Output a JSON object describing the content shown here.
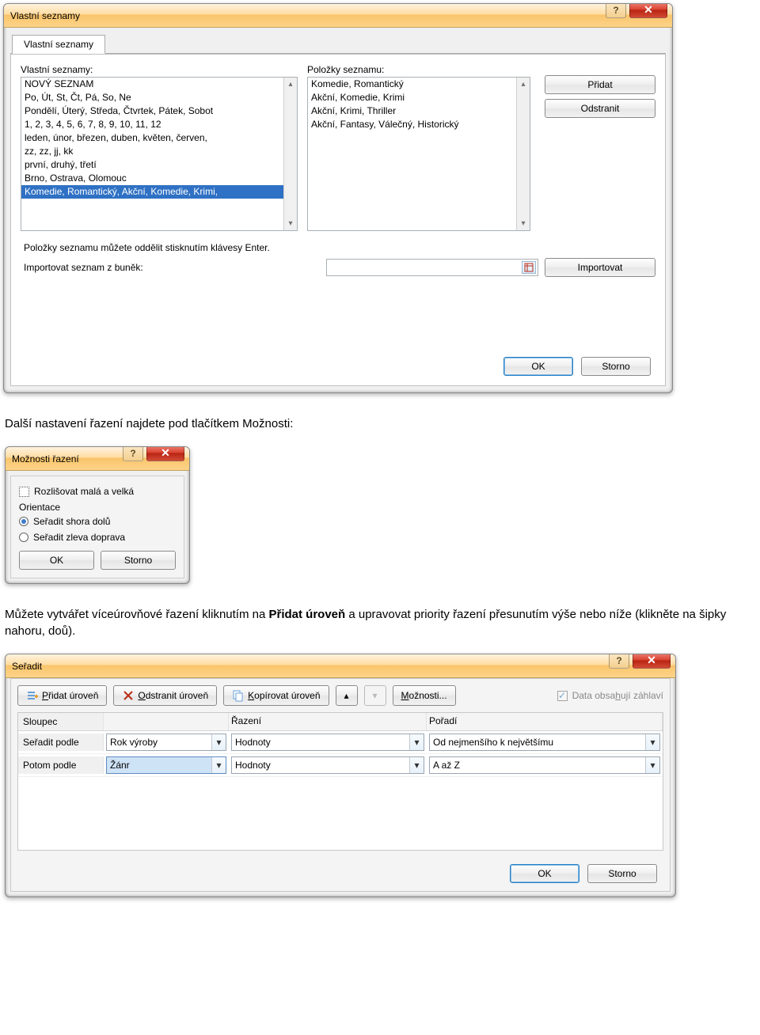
{
  "dlg1": {
    "title": "Vlastní seznamy",
    "tab": "Vlastní seznamy",
    "list_label": "Vlastní seznamy:",
    "list_items": [
      "NOVÝ SEZNAM",
      "Po, Út, St, Čt, Pá, So, Ne",
      "Pondělí, Úterý, Středa, Čtvrtek, Pátek, Sobot",
      "1, 2, 3, 4, 5, 6, 7, 8, 9, 10, 11, 12",
      "leden, únor, březen, duben, květen, červen,",
      "zz, zz, jj, kk",
      "první, druhý, třetí",
      "Brno, Ostrava, Olomouc",
      "Komedie, Romantický, Akční, Komedie, Krimi,"
    ],
    "list_selected_index": 8,
    "entries_label": "Položky seznamu:",
    "entries": [
      "Komedie, Romantický",
      "Akční, Komedie, Krimi",
      "Akční, Krimi, Thriller",
      "Akční, Fantasy, Válečný, Historický"
    ],
    "btn_add": "Přidat",
    "btn_remove": "Odstranit",
    "hint": "Položky seznamu můžete oddělit stisknutím klávesy Enter.",
    "import_label": "Importovat seznam z buněk:",
    "btn_import": "Importovat",
    "btn_ok": "OK",
    "btn_cancel": "Storno"
  },
  "para1": "Další nastavení řazení najdete pod tlačítkem Možnosti:",
  "dlg2": {
    "title": "Možnosti řazení",
    "chk_case": "Rozlišovat malá a velká",
    "group": "Orientace",
    "radio_top": "Seřadit shora dolů",
    "radio_left": "Seřadit zleva doprava",
    "radio_selected": 0,
    "btn_ok": "OK",
    "btn_cancel": "Storno"
  },
  "para2_pre": "Můžete vytvářet víceúrovňové řazení kliknutím na ",
  "para2_bold": "Přidat úroveň",
  "para2_post": " a upravovat priority řazení přesunutím výše nebo níže (klikněte na šipky nahoru, doů).",
  "dlg3": {
    "title": "Seřadit",
    "btn_add": "Přidat úroveň",
    "btn_del": "Odstranit úroveň",
    "btn_copy": "Kopírovat úroveň",
    "btn_opt": "Možnosti...",
    "chk_header": "Data obsahují záhlaví",
    "hdr_col": "Sloupec",
    "hdr_sort": "Řazení",
    "hdr_order": "Pořadí",
    "rows": [
      {
        "lbl": "Seřadit podle",
        "col": "Rok výroby",
        "sort": "Hodnoty",
        "order": "Od nejmenšího k největšímu",
        "active": false
      },
      {
        "lbl": "Potom podle",
        "col": "Žánr",
        "sort": "Hodnoty",
        "order": "A až Z",
        "active": true
      }
    ],
    "btn_ok": "OK",
    "btn_cancel": "Storno"
  }
}
